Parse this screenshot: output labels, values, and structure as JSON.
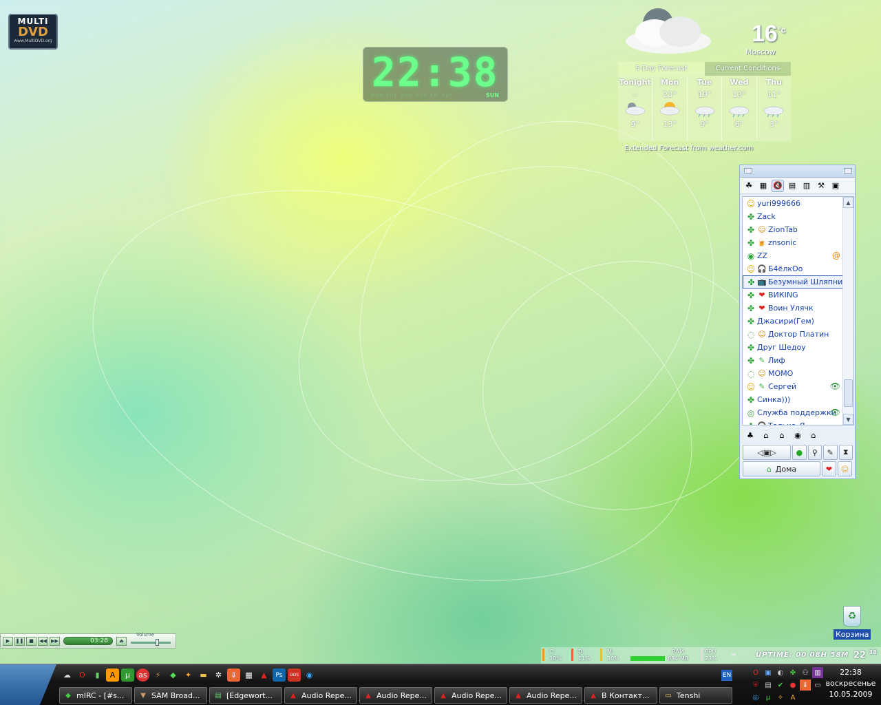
{
  "desktop": {
    "logo": {
      "line1": "MULTI",
      "line2": "DVD",
      "url": "www.MultiDVD.org"
    },
    "clock": {
      "time": "22:38",
      "days": "MON  TUE  WED  THU  FRI  SAT",
      "day": "SUN"
    },
    "weather": {
      "temp": "16",
      "unit": "°c",
      "city": "Moscow",
      "tabs": [
        "5-Day Forecast",
        "Current Conditions"
      ],
      "days": [
        {
          "name": "Tonight",
          "high": "--",
          "low": "9°",
          "icon": "cloud-night-icon"
        },
        {
          "name": "Mon",
          "high": "23°",
          "low": "13°",
          "icon": "sun-cloud-icon"
        },
        {
          "name": "Tue",
          "high": "19°",
          "low": "9°",
          "icon": "rain-cloud-icon"
        },
        {
          "name": "Wed",
          "high": "13°",
          "low": "6°",
          "icon": "rain-cloud-icon"
        },
        {
          "name": "Thu",
          "high": "11°",
          "low": "3°",
          "icon": "rain-cloud-icon"
        }
      ],
      "footer": "Extended Forecast from weather.com"
    },
    "recycle_bin": "Корзина"
  },
  "icq": {
    "contacts": [
      {
        "name": "yuri999666",
        "status": "☺",
        "extra": ""
      },
      {
        "name": "Zack",
        "status": "✤",
        "extra": ""
      },
      {
        "name": "ZionTab",
        "status": "✤",
        "extra": "☺"
      },
      {
        "name": "znsonic",
        "status": "✤",
        "extra": "🍺"
      },
      {
        "name": "ZZ",
        "status": "◉",
        "extra": "",
        "right": "@"
      },
      {
        "name": "Б4ёлкОо",
        "status": "☺",
        "extra": "🎧"
      },
      {
        "name": "Безумный Шляпник",
        "status": "✤",
        "extra": "📺",
        "selected": true
      },
      {
        "name": "ВИКING",
        "status": "✤",
        "extra": "❤"
      },
      {
        "name": "Воин Улячк",
        "status": "✤",
        "extra": "❤"
      },
      {
        "name": "Джасири(Гем)",
        "status": "✤",
        "extra": ""
      },
      {
        "name": "Доктор Платин",
        "status": "◌",
        "extra": "☺"
      },
      {
        "name": "Друг Шедоу",
        "status": "✤",
        "extra": ""
      },
      {
        "name": "Лиф",
        "status": "✤",
        "extra": "✎"
      },
      {
        "name": "МОМО",
        "status": "◌",
        "extra": "☺"
      },
      {
        "name": "Сергей",
        "status": "☺",
        "extra": "✎",
        "right": "👁"
      },
      {
        "name": "Синка)))",
        "status": "✤",
        "extra": ""
      },
      {
        "name": "Служба поддержки",
        "status": "◎",
        "extra": "",
        "right": "👁"
      },
      {
        "name": "Только_Я",
        "status": "✤",
        "extra": "🎧"
      }
    ],
    "status_button": "Дома",
    "colors": {
      "contact_text": "#1640b0",
      "online_green": "#2fa63a"
    }
  },
  "player": {
    "time": "03:28",
    "volume_label": "Volume"
  },
  "sysmon": {
    "c_label": "C:",
    "c_val": "30%",
    "d_label": "D:",
    "d_val": "11%",
    "m_label": "M:",
    "m_val": "30%",
    "ram_label": "RAM",
    "ram_val": "684 MB",
    "cpu_label": "CPU",
    "cpu_val": "23%",
    "uptime": "UPTIME:  00  08H  58M",
    "time": "22",
    "time_min": "38"
  },
  "taskbar": {
    "tasks": [
      {
        "label": "mIRC - [#s...",
        "icon": "◆",
        "color": "#4c4"
      },
      {
        "label": "SAM Broad...",
        "icon": "▼",
        "color": "#c96"
      },
      {
        "label": "[Edgewort...",
        "icon": "▤",
        "color": "#6c6"
      },
      {
        "label": "Audio Repe...",
        "icon": "▲",
        "color": "#d22"
      },
      {
        "label": "Audio Repe...",
        "icon": "▲",
        "color": "#d22"
      },
      {
        "label": "Audio Repe...",
        "icon": "▲",
        "color": "#d22"
      },
      {
        "label": "Audio Repe...",
        "icon": "▲",
        "color": "#d22"
      },
      {
        "label": "В Контакт...",
        "icon": "▲",
        "color": "#d22"
      },
      {
        "label": "Tenshi",
        "icon": "▭",
        "color": "#eec25a"
      }
    ],
    "lang": "EN",
    "clock": {
      "time": "22:38",
      "day": "воскресенье",
      "date": "10.05.2009"
    }
  }
}
